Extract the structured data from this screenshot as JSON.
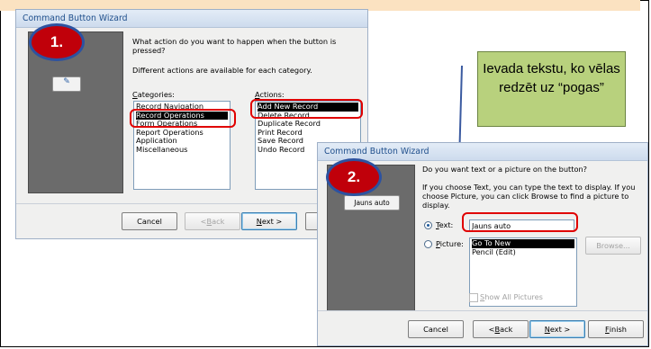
{
  "dialog1": {
    "title": "Command Button Wizard",
    "badge": "1.",
    "question": "What action do you want to happen when the button is pressed?",
    "info": "Different actions are available for each category.",
    "categories_label_u": "C",
    "categories_label_rest": "ategories:",
    "actions_label_u": "A",
    "actions_label_rest": "ctions:",
    "categories": [
      "Record Navigation",
      "Record Operations",
      "Form Operations",
      "Report Operations",
      "Application",
      "Miscellaneous"
    ],
    "actions": [
      "Add New Record",
      "Delete Record",
      "Duplicate Record",
      "Print Record",
      "Save Record",
      "Undo Record"
    ],
    "buttons": {
      "cancel": "Cancel",
      "back_pre": "< ",
      "back_u": "B",
      "back_rest": "ack",
      "next_u": "N",
      "next_rest": "ext >"
    }
  },
  "dialog2": {
    "title": "Command Button Wizard",
    "badge": "2.",
    "question": "Do you want text or a picture on the button?",
    "info": "If you choose Text, you can type the text to display.  If you choose Picture, you can click Browse to find a picture to display.",
    "preview_button": "Jauns auto",
    "text_label_u": "T",
    "text_label_rest": "ext:",
    "text_value": "Jauns auto",
    "picture_label_u": "P",
    "picture_label_rest": "icture:",
    "picture_items": [
      "Go To New",
      "Pencil (Edit)"
    ],
    "browse": "Browse...",
    "show_all_u": "S",
    "show_all_rest": "how All Pictures",
    "buttons": {
      "cancel": "Cancel",
      "back_pre": "< ",
      "back_u": "B",
      "back_rest": "ack",
      "next_u": "N",
      "next_rest": "ext >",
      "finish_u": "F",
      "finish_rest": "inish"
    }
  },
  "callout": {
    "text": "Ievada tekstu, ko vēlas redzēt uz “pogas”"
  },
  "colors": {
    "badge_fill": "#c0000a",
    "highlight": "#e00000",
    "note_fill": "#b8d17d",
    "selection": "#000000"
  }
}
